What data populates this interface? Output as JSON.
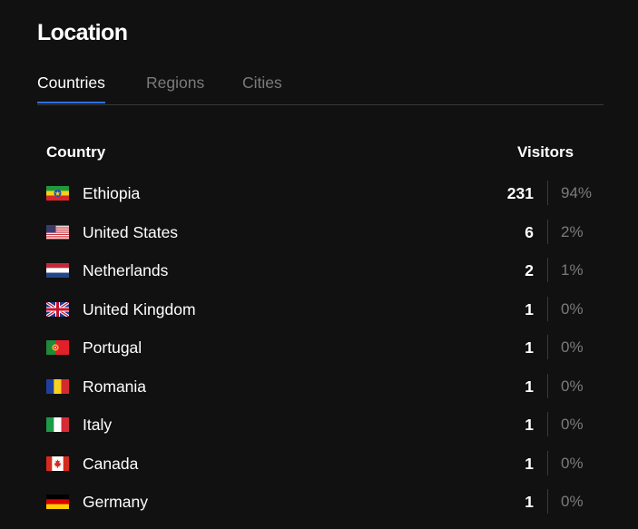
{
  "card": {
    "title": "Location"
  },
  "tabs": [
    {
      "label": "Countries",
      "active": true
    },
    {
      "label": "Regions",
      "active": false
    },
    {
      "label": "Cities",
      "active": false
    }
  ],
  "table": {
    "col_country": "Country",
    "col_visitors": "Visitors",
    "rows": [
      {
        "flag": "ethiopia-flag-icon",
        "country": "Ethiopia",
        "visitors": "231",
        "percent": "94%"
      },
      {
        "flag": "united-states-flag-icon",
        "country": "United States",
        "visitors": "6",
        "percent": "2%"
      },
      {
        "flag": "netherlands-flag-icon",
        "country": "Netherlands",
        "visitors": "2",
        "percent": "1%"
      },
      {
        "flag": "united-kingdom-flag-icon",
        "country": "United Kingdom",
        "visitors": "1",
        "percent": "0%"
      },
      {
        "flag": "portugal-flag-icon",
        "country": "Portugal",
        "visitors": "1",
        "percent": "0%"
      },
      {
        "flag": "romania-flag-icon",
        "country": "Romania",
        "visitors": "1",
        "percent": "0%"
      },
      {
        "flag": "italy-flag-icon",
        "country": "Italy",
        "visitors": "1",
        "percent": "0%"
      },
      {
        "flag": "canada-flag-icon",
        "country": "Canada",
        "visitors": "1",
        "percent": "0%"
      },
      {
        "flag": "germany-flag-icon",
        "country": "Germany",
        "visitors": "1",
        "percent": "0%"
      }
    ]
  },
  "colors": {
    "background": "#111111",
    "accent": "#2f6fe4",
    "muted_text": "#7b7b7b",
    "divider": "#3a3a3a"
  }
}
